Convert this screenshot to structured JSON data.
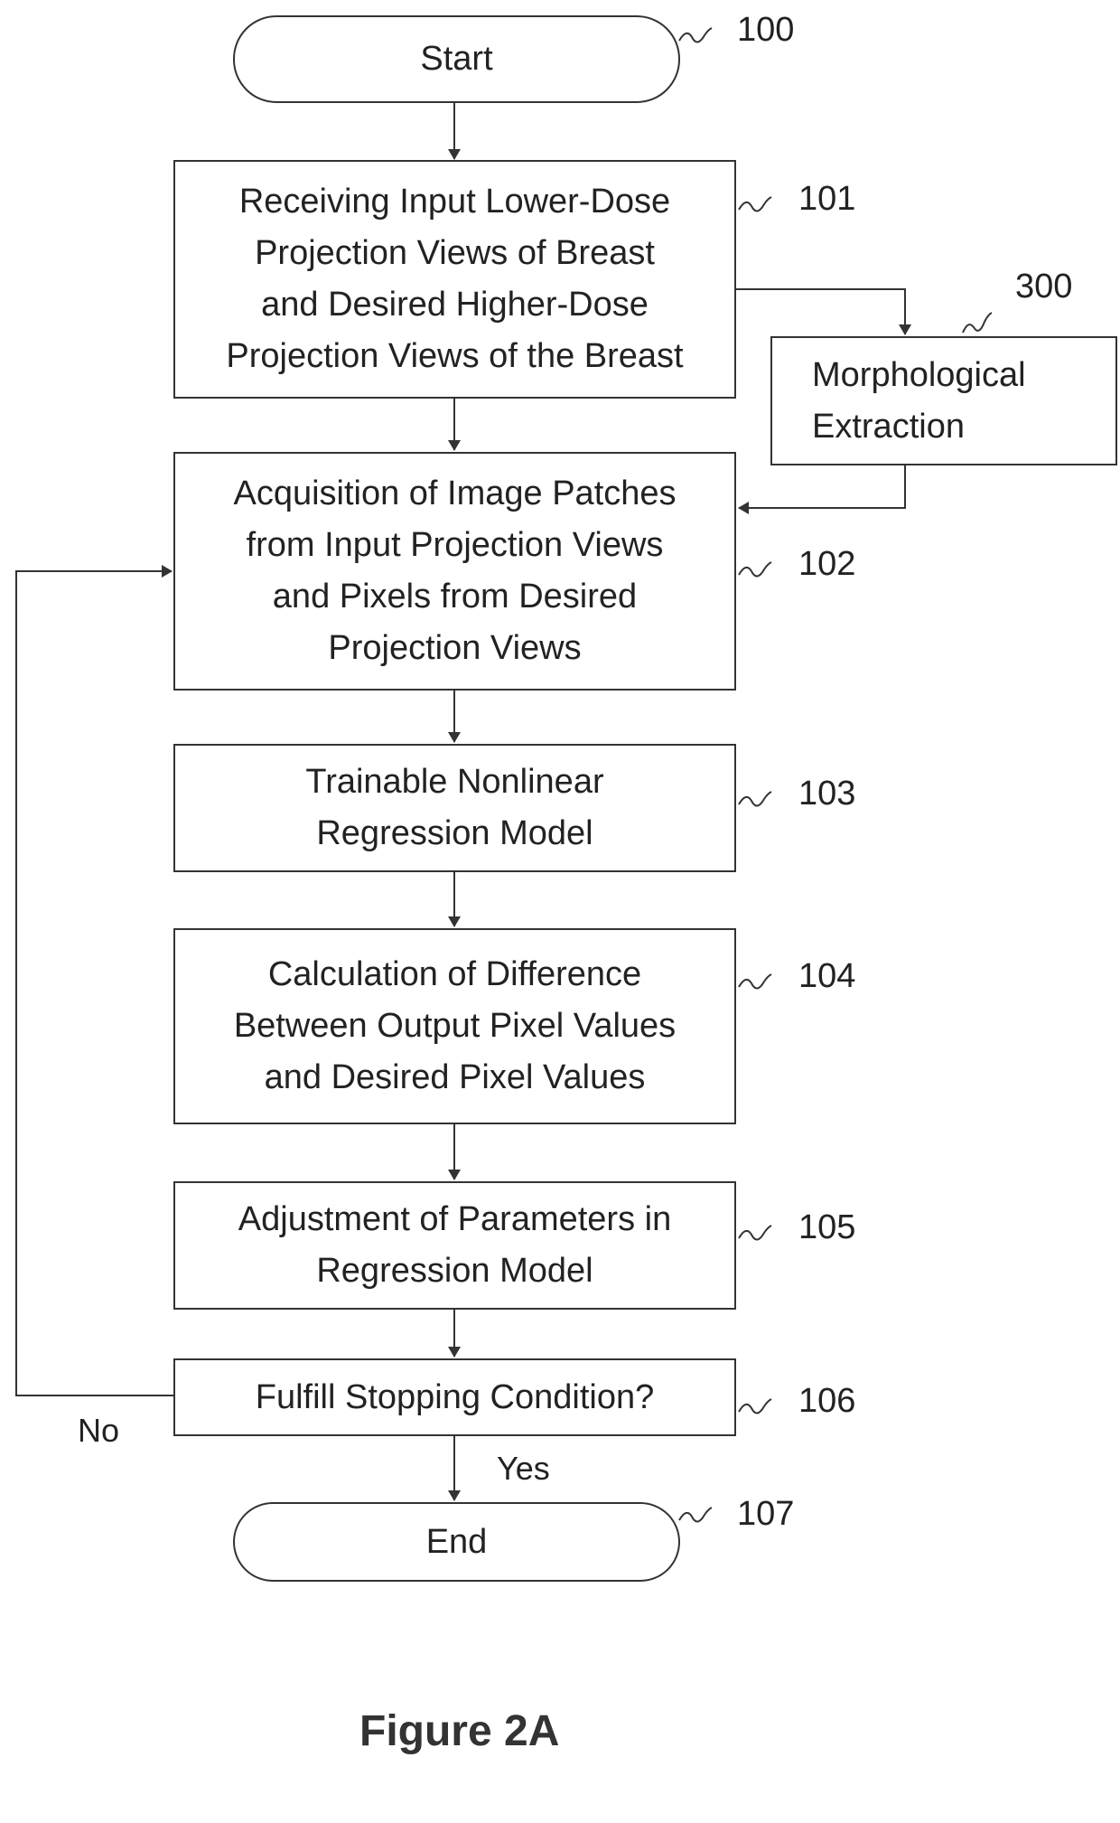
{
  "figure": {
    "title": "Figure 2A",
    "nodes": [
      {
        "id": "100",
        "type": "terminal",
        "label": "Start"
      },
      {
        "id": "101",
        "type": "process",
        "label": "Receiving Input Lower-Dose Projection Views of Breast and Desired Higher-Dose Projection Views of the Breast",
        "lines": [
          "Receiving Input Lower-Dose",
          "Projection Views of Breast",
          "and Desired Higher-Dose",
          "Projection Views of the Breast"
        ]
      },
      {
        "id": "300",
        "type": "process",
        "label": "Morphological Extraction",
        "lines": [
          "Morphological",
          "Extraction"
        ]
      },
      {
        "id": "102",
        "type": "process",
        "label": "Acquisition of Image Patches from Input Projection Views and Pixels from Desired Projection Views",
        "lines": [
          "Acquisition of Image Patches",
          "from Input Projection Views",
          "and Pixels from Desired",
          "Projection Views"
        ]
      },
      {
        "id": "103",
        "type": "process",
        "label": "Trainable Nonlinear Regression Model",
        "lines": [
          "Trainable Nonlinear",
          "Regression Model"
        ]
      },
      {
        "id": "104",
        "type": "process",
        "label": "Calculation of Difference Between Output Pixel Values and Desired Pixel Values",
        "lines": [
          "Calculation of Difference",
          "Between Output Pixel Values",
          "and Desired Pixel Values"
        ]
      },
      {
        "id": "105",
        "type": "process",
        "label": "Adjustment of Parameters in Regression Model",
        "lines": [
          "Adjustment of Parameters in",
          "Regression Model"
        ]
      },
      {
        "id": "106",
        "type": "decision",
        "label": "Fulfill Stopping Condition?"
      },
      {
        "id": "107",
        "type": "terminal",
        "label": "End"
      }
    ],
    "edges": [
      {
        "from": "100",
        "to": "101",
        "label": ""
      },
      {
        "from": "101",
        "to": "102",
        "label": ""
      },
      {
        "from": "101",
        "to": "300",
        "label": ""
      },
      {
        "from": "300",
        "to": "102",
        "label": ""
      },
      {
        "from": "102",
        "to": "103",
        "label": ""
      },
      {
        "from": "103",
        "to": "104",
        "label": ""
      },
      {
        "from": "104",
        "to": "105",
        "label": ""
      },
      {
        "from": "105",
        "to": "106",
        "label": ""
      },
      {
        "from": "106",
        "to": "102",
        "label": "No"
      },
      {
        "from": "106",
        "to": "107",
        "label": "Yes"
      }
    ],
    "edge_labels": {
      "no": "No",
      "yes": "Yes"
    }
  }
}
